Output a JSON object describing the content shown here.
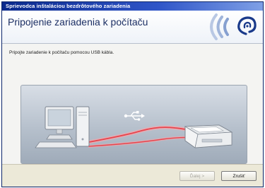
{
  "window": {
    "title": "Sprievodca inštaláciou bezdrôtového zariadenia",
    "heading": "Pripojenie zariadenia k počítaču"
  },
  "content": {
    "instruction": "Pripojte zariadenie k počítaču pomocou USB kábla."
  },
  "illustration": {
    "icons": [
      "computer-icon",
      "usb-icon",
      "printer-icon"
    ],
    "cable_color": "#e8444c"
  },
  "footer": {
    "next_label": "Ďalej >",
    "close_label": "Zrušiť"
  },
  "colors": {
    "title_bar": "#0b2a8c",
    "heading_text": "#1c2f64",
    "logo_blue": "#1a3a8a"
  }
}
